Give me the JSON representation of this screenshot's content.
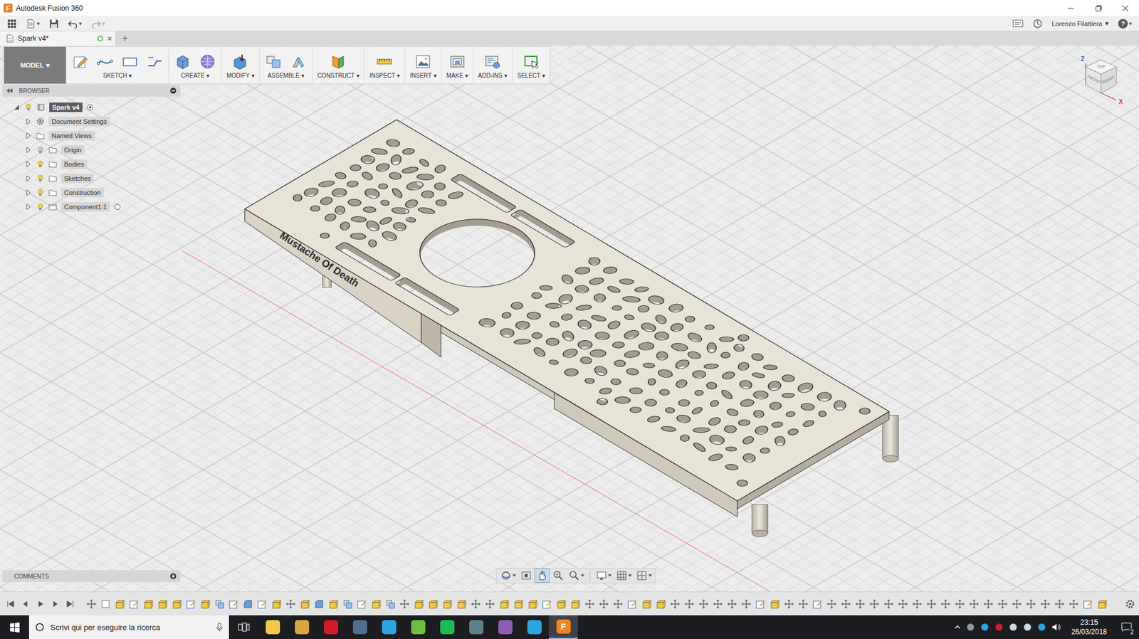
{
  "window": {
    "logo": "F",
    "title": "Autodesk Fusion 360"
  },
  "quick_access": {
    "file": {
      "caret": "▾"
    },
    "undo": {
      "caret": "▾",
      "disabled": false
    },
    "redo": {
      "caret": "▾",
      "disabled": true
    },
    "user": {
      "name": "Lorenzo Filattiera",
      "caret": "▾"
    },
    "help": {
      "label": "?",
      "caret": "▾"
    }
  },
  "document_tabs": [
    {
      "label": "Spark v4*",
      "close": "×",
      "selected": true
    }
  ],
  "new_tab": "+",
  "workspace": {
    "label": "MODEL",
    "caret": "▾"
  },
  "toolbar": [
    {
      "label": "SKETCH",
      "caret": "▾"
    },
    {
      "label": "CREATE",
      "caret": "▾"
    },
    {
      "label": "MODIFY",
      "caret": "▾"
    },
    {
      "label": "ASSEMBLE",
      "caret": "▾"
    },
    {
      "label": "CONSTRUCT",
      "caret": "▾"
    },
    {
      "label": "INSPECT",
      "caret": "▾"
    },
    {
      "label": "INSERT",
      "caret": "▾"
    },
    {
      "label": "MAKE",
      "caret": "▾"
    },
    {
      "label": "ADD-INS",
      "caret": "▾"
    },
    {
      "label": "SELECT",
      "caret": "▾"
    }
  ],
  "browser": {
    "title": "BROWSER",
    "items": [
      {
        "label": "Spark v4",
        "kind": "root",
        "expanded": true,
        "visible": true,
        "selected": true
      },
      {
        "label": "Document Settings",
        "kind": "settings",
        "expanded": false,
        "selected": false
      },
      {
        "label": "Named Views",
        "kind": "folder",
        "expanded": false,
        "selected": false
      },
      {
        "label": "Origin",
        "kind": "folder",
        "expanded": false,
        "visible": false,
        "selected": false
      },
      {
        "label": "Bodies",
        "kind": "folder",
        "expanded": false,
        "visible": true,
        "selected": false
      },
      {
        "label": "Sketches",
        "kind": "folder",
        "expanded": false,
        "visible": true,
        "selected": false
      },
      {
        "label": "Construction",
        "kind": "folder",
        "expanded": false,
        "visible": true,
        "selected": false
      },
      {
        "label": "Component1:1",
        "kind": "component",
        "expanded": false,
        "visible": true,
        "selected": false
      }
    ]
  },
  "comments": {
    "title": "COMMENTS"
  },
  "model": {
    "engraving": "Mustache Of Death"
  },
  "viewcube": {
    "faces": [
      "TOP",
      "FRONT",
      "RIGHT"
    ],
    "axes": [
      {
        "label": "Z",
        "color": "#2f55d4"
      },
      {
        "label": "X",
        "color": "#d9362b"
      }
    ]
  },
  "nav_bar": [
    {
      "kind": "orbit",
      "selected": false
    },
    {
      "kind": "look",
      "selected": false
    },
    {
      "kind": "pan",
      "selected": true
    },
    {
      "kind": "zoom",
      "selected": false
    },
    {
      "kind": "fit",
      "selected": false
    },
    {
      "kind": "display",
      "selected": false
    },
    {
      "kind": "grid",
      "selected": false
    },
    {
      "kind": "viewports",
      "selected": false
    }
  ],
  "taskbar": {
    "search": {
      "placeholder": "Scrivi qui per eseguire la ricerca"
    },
    "apps": [
      {
        "color": "#f2c84b",
        "active": false
      },
      {
        "color": "#d9a441",
        "active": false
      },
      {
        "color": "#d11a2a",
        "active": false
      },
      {
        "color": "#4f6f8f",
        "active": false
      },
      {
        "color": "#2ca5e0",
        "active": false
      },
      {
        "color": "#6cbf3f",
        "active": false
      },
      {
        "color": "#1db954",
        "active": false
      },
      {
        "color": "#5e7f8c",
        "active": false
      },
      {
        "color": "#8e5bb5",
        "active": false
      },
      {
        "color": "#2ca5e0",
        "active": false
      },
      {
        "color": "#f58220",
        "active": true,
        "glyph": "F"
      }
    ],
    "clock": {
      "time": "23:15",
      "date": "26/03/2018"
    },
    "notifications": "2"
  }
}
